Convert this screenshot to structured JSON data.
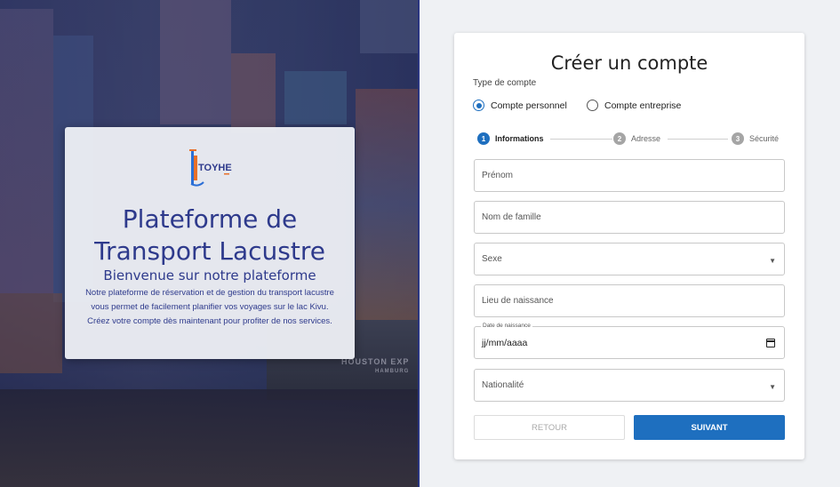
{
  "hero": {
    "logo_text": "TOYHE",
    "title": "Plateforme de Transport Lacustre",
    "subtitle": "Bienvenue sur notre plateforme",
    "description": "Notre plateforme de réservation et de gestion du transport lacustre vous permet de facilement planifier vos voyages sur le lac Kivu. Créez votre compte dès maintenant pour profiter de nos services.",
    "ship_text": "HOUSTON EXP",
    "ship_subtext": "HAMBURG"
  },
  "form": {
    "title": "Créer un compte",
    "account_type_label": "Type de compte",
    "account_types": [
      {
        "label": "Compte personnel",
        "selected": true
      },
      {
        "label": "Compte entreprise",
        "selected": false
      }
    ],
    "steps": [
      {
        "number": "1",
        "label": "Informations",
        "active": true
      },
      {
        "number": "2",
        "label": "Adresse",
        "active": false
      },
      {
        "number": "3",
        "label": "Sécurité",
        "active": false
      }
    ],
    "fields": {
      "first_name_placeholder": "Prénom",
      "last_name_placeholder": "Nom de famille",
      "sex_placeholder": "Sexe",
      "birthplace_placeholder": "Lieu de naissance",
      "birthdate_label": "Date de naissance",
      "birthdate_value": "jj/mm/aaaa",
      "nationality_placeholder": "Nationalité"
    },
    "buttons": {
      "back": "RETOUR",
      "next": "SUIVANT"
    }
  },
  "colors": {
    "primary": "#1e6fbf",
    "hero_text": "#2e3a8c"
  }
}
